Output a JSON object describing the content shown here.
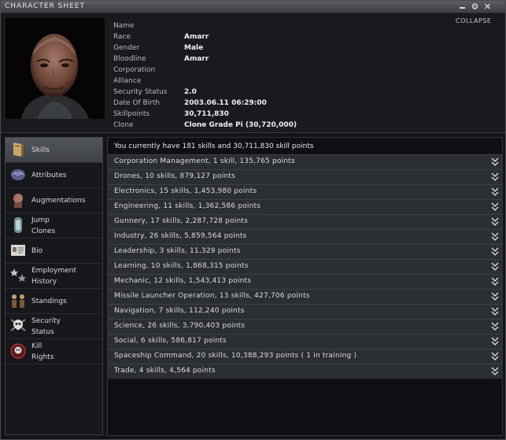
{
  "window": {
    "title": "CHARACTER SHEET",
    "buttons": [
      "minimize",
      "settings",
      "close"
    ]
  },
  "header": {
    "collapse_label": "COLLAPSE",
    "fields": [
      {
        "label": "Name",
        "value": ""
      },
      {
        "label": "Race",
        "value": "Amarr"
      },
      {
        "label": "Gender",
        "value": "Male"
      },
      {
        "label": "Bloodline",
        "value": "Amarr"
      },
      {
        "label": "Corporation",
        "value": ""
      },
      {
        "label": "Alliance",
        "value": ""
      },
      {
        "label": "Security Status",
        "value": "2.0"
      },
      {
        "label": "Date Of Birth",
        "value": "2003.06.11  06:29:00"
      },
      {
        "label": "Skillpoints",
        "value": "30,711,830"
      },
      {
        "label": "Clone",
        "value": "Clone Grade Pi (30,720,000)"
      }
    ]
  },
  "sidebar": {
    "items": [
      {
        "line1": "Skills",
        "line2": "",
        "icon": "skills-book-icon",
        "active": true
      },
      {
        "line1": "Attributes",
        "line2": "",
        "icon": "attributes-brain-icon",
        "active": false
      },
      {
        "line1": "Augmentations",
        "line2": "",
        "icon": "augmentations-head-icon",
        "active": false
      },
      {
        "line1": "Jump",
        "line2": "Clones",
        "icon": "clone-vat-icon",
        "active": false
      },
      {
        "line1": "Bio",
        "line2": "",
        "icon": "bio-card-icon",
        "active": false
      },
      {
        "line1": "Employment",
        "line2": "History",
        "icon": "employment-stars-icon",
        "active": false
      },
      {
        "line1": "Standings",
        "line2": "",
        "icon": "standings-people-icon",
        "active": false
      },
      {
        "line1": "Security",
        "line2": "Status",
        "icon": "security-skull-icon",
        "active": false
      },
      {
        "line1": "Kill",
        "line2": "Rights",
        "icon": "kill-rights-icon",
        "active": false
      }
    ]
  },
  "skills": {
    "summary": "You currently have 181 skills and 30,711,830 skill points",
    "groups": [
      "Corporation Management, 1 skill, 135,765 points",
      "Drones, 10 skills, 879,127 points",
      "Electronics, 15 skills, 1,453,980 points",
      "Engineering, 11 skills, 1,362,586 points",
      "Gunnery, 17 skills, 2,287,728 points",
      "Industry, 26 skills, 5,859,564 points",
      "Leadership, 3 skills, 11,329 points",
      "Learning, 10 skills, 1,868,315 points",
      "Mechanic, 12 skills, 1,543,413 points",
      "Missile Launcher Operation, 13 skills, 427,706 points",
      "Navigation, 7 skills, 112,240 points",
      "Science, 26 skills, 3,790,403 points",
      "Social, 6 skills, 586,817 points",
      "Spaceship Command, 20 skills, 10,388,293 points ( 1 in training )",
      "Trade, 4 skills, 4,564 points"
    ]
  },
  "colors": {
    "accent_gold": "#d9a441",
    "panel": "#2b2e32",
    "background": "#0e1013"
  }
}
